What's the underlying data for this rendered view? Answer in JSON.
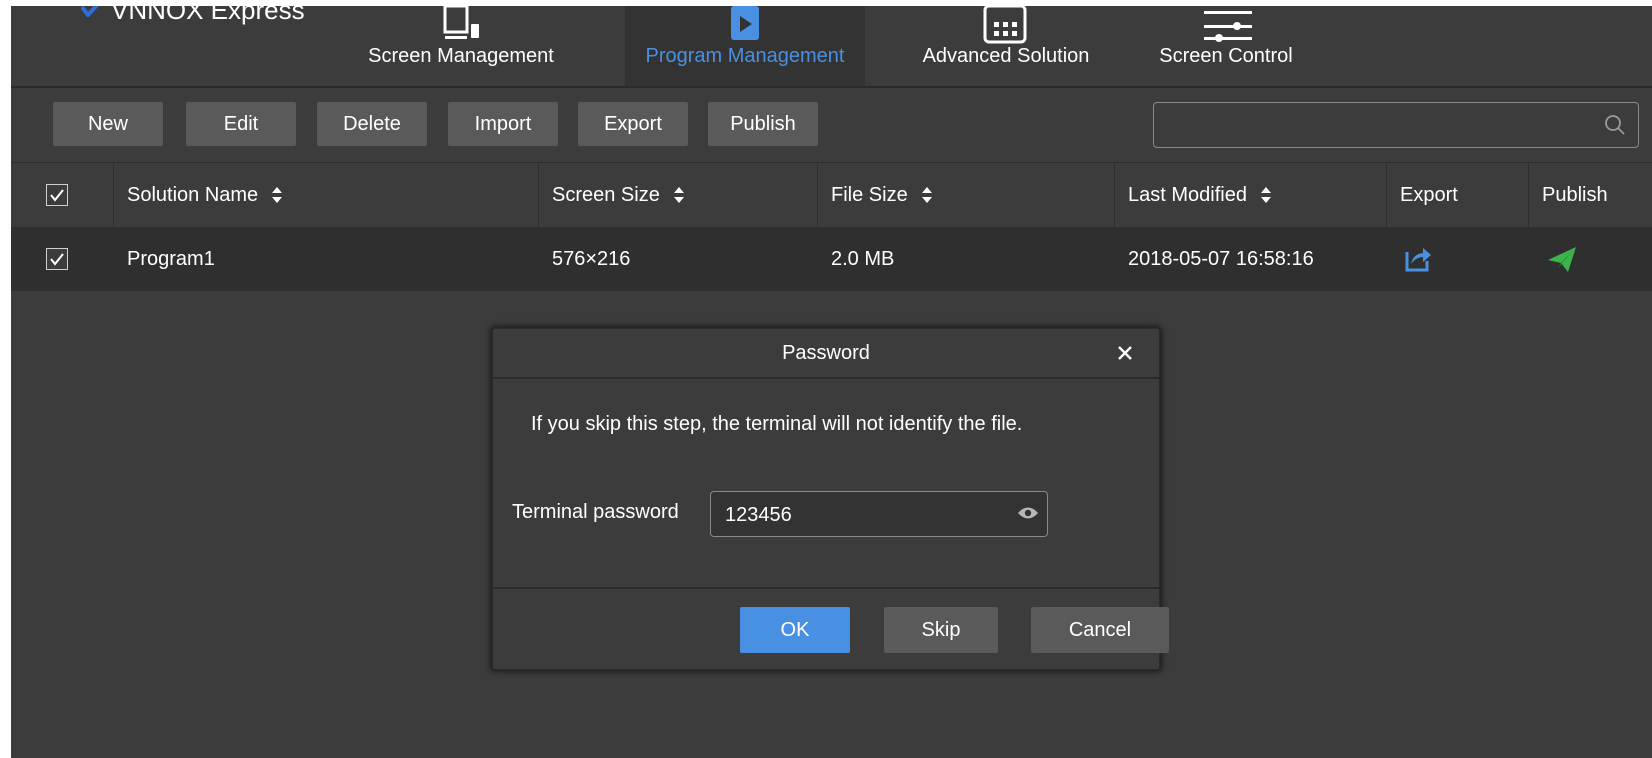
{
  "app": {
    "brand": "VNNOX Express"
  },
  "nav": {
    "tabs": [
      {
        "label": "Screen Management",
        "icon": "monitor-icon"
      },
      {
        "label": "Program Management",
        "icon": "play-icon",
        "active": true
      },
      {
        "label": "Advanced Solution",
        "icon": "calendar-icon"
      },
      {
        "label": "Screen Control",
        "icon": "sliders-icon"
      }
    ]
  },
  "toolbar": {
    "buttons": [
      "New",
      "Edit",
      "Delete",
      "Import",
      "Export",
      "Publish"
    ],
    "search": {
      "value": "",
      "placeholder": ""
    }
  },
  "table": {
    "headers": [
      "Solution Name",
      "Screen Size",
      "File Size",
      "Last Modified",
      "Export",
      "Publish"
    ],
    "rows": [
      {
        "checked": true,
        "name": "Program1",
        "screen_size": "576×216",
        "file_size": "2.0 MB",
        "last_modified": "2018-05-07 16:58:16"
      }
    ]
  },
  "dialog": {
    "title": "Password",
    "message": "If you skip this step, the terminal will not identify the file.",
    "password_label": "Terminal password",
    "password_value": "123456",
    "ok_label": "OK",
    "skip_label": "Skip",
    "cancel_label": "Cancel"
  },
  "colors": {
    "background": "#3c3c3c",
    "accent_blue": "#4a90e2",
    "publish_green": "#3cb44b",
    "button_gray": "#5a5a5a"
  }
}
